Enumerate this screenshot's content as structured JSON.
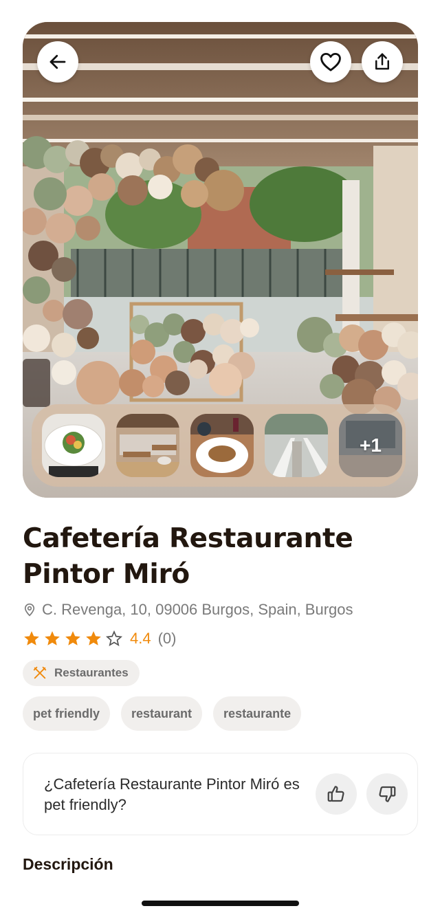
{
  "place": {
    "name": "Cafetería Restaurante Pintor Miró",
    "address": "C. Revenga, 10, 09006 Burgos, Spain, Burgos",
    "rating_value": "4.4",
    "rating_count": "(0)",
    "rating_stars": 4,
    "category": "Restaurantes",
    "tags": [
      "pet friendly",
      "restaurant",
      "restaurante"
    ]
  },
  "gallery": {
    "more_label": "+1"
  },
  "pet_question": {
    "text": "¿Cafetería Restaurante Pintor Miró es pet friendly?"
  },
  "sections": {
    "description_title": "Descripción"
  },
  "icons": {
    "back": "arrow-left-icon",
    "favorite": "heart-icon",
    "share": "share-icon",
    "location": "location-pin-icon",
    "star": "star-icon",
    "category": "utensils-icon",
    "thumbs_up": "thumbs-up-icon",
    "thumbs_down": "thumbs-down-icon"
  },
  "colors": {
    "accent": "#f08a0c",
    "chip_bg": "#f1efed",
    "title": "#22170f"
  }
}
